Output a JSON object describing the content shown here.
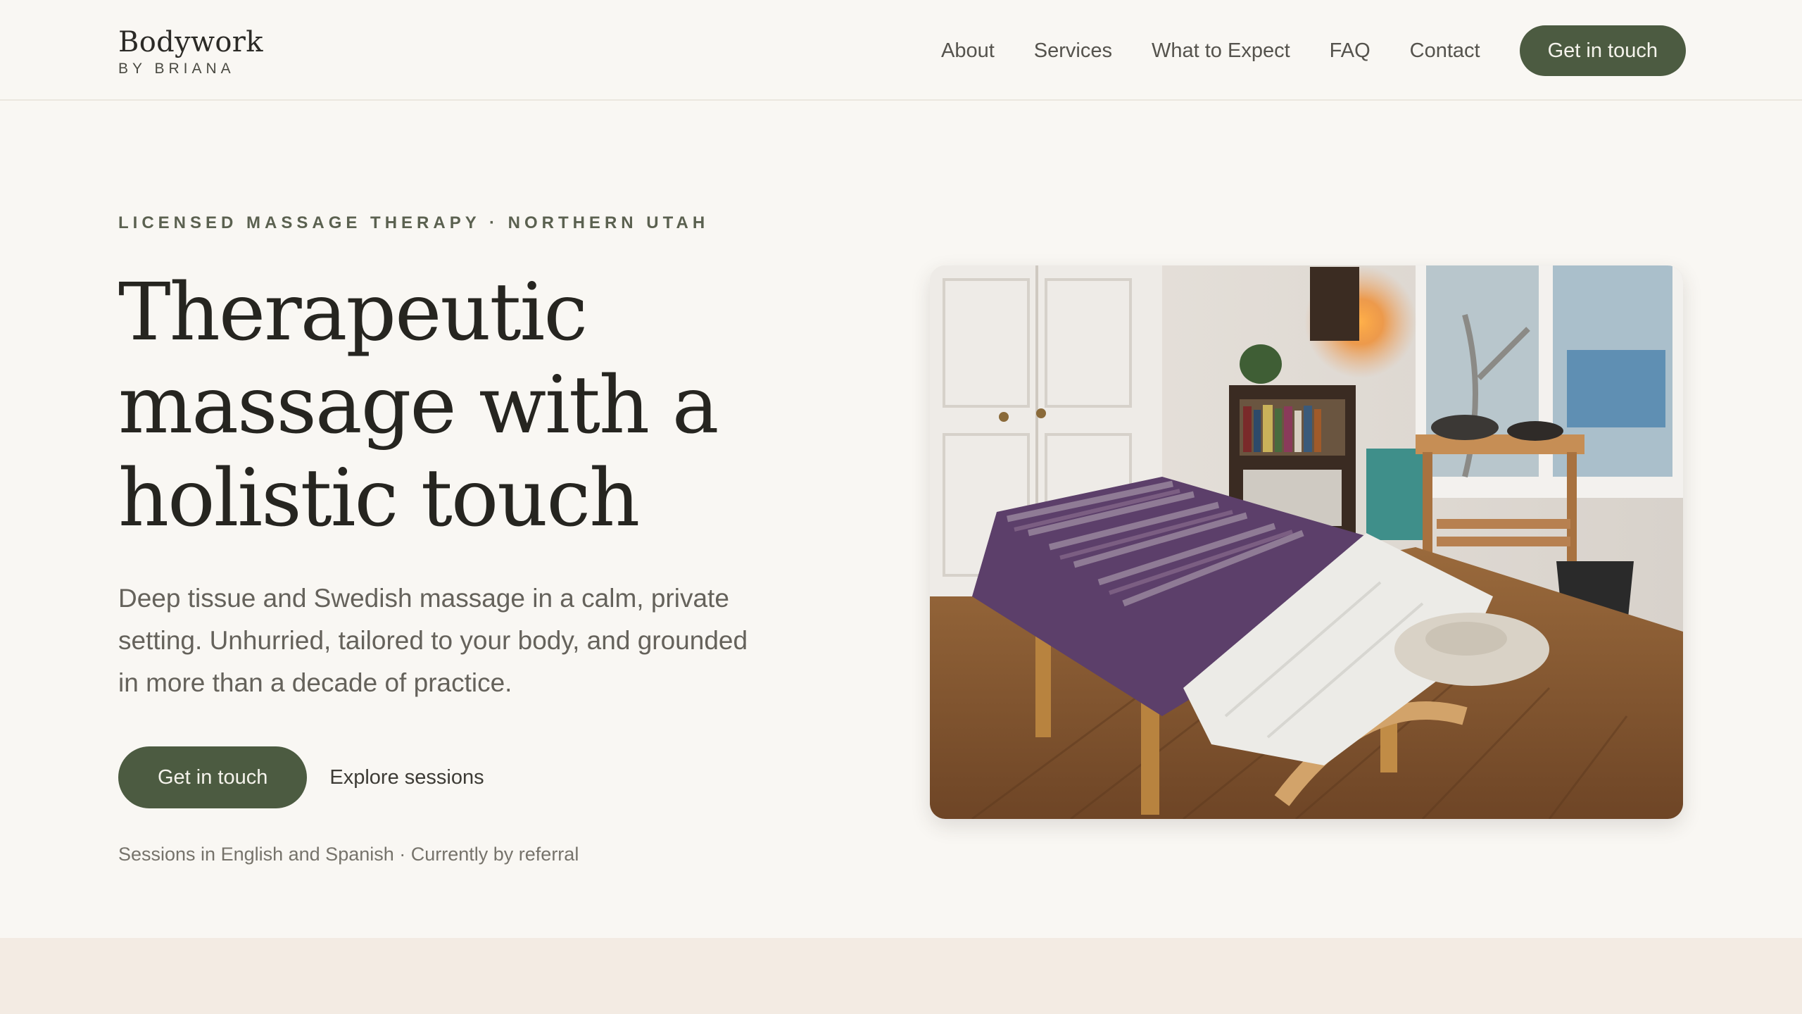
{
  "brand": {
    "name": "Bodywork",
    "sub": "BY BRIANA"
  },
  "nav": {
    "links": [
      "About",
      "Services",
      "What to Expect",
      "FAQ",
      "Contact"
    ],
    "cta": "Get in touch"
  },
  "hero": {
    "eyebrow": "LICENSED MASSAGE THERAPY · NORTHERN UTAH",
    "headline_lines": [
      "Therapeutic",
      "massage with a",
      "holistic touch"
    ],
    "lede": "Deep tissue and Swedish massage in a calm, private setting. Unhurried, tailored to your body, and grounded in more than a decade of practice.",
    "primary_cta": "Get in touch",
    "secondary_cta": "Explore sessions",
    "note": "Sessions in English and Spanish · Currently by referral"
  },
  "colors": {
    "background": "#f9f7f3",
    "accent": "#4c5b41",
    "lower_band": "#f3ebe3"
  }
}
